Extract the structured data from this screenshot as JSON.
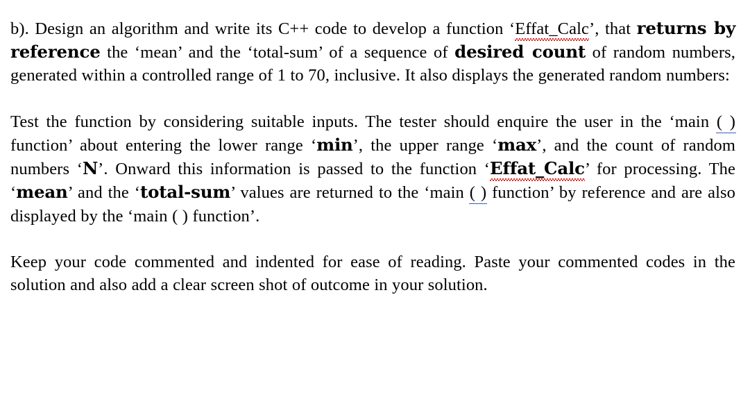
{
  "document": {
    "background_color": "#ffffff",
    "text_color": "#000000",
    "spellcheck_underline_color": "#d93025",
    "grammar_underline_color": "#3b5bbf",
    "paragraphs": [
      {
        "id": "paragraph-1",
        "segments": [
          {
            "text": "b). Design an algorithm and write its C++ code to develop a function ",
            "style": "normal"
          },
          {
            "text": "‘",
            "style": "normal"
          },
          {
            "text": "Effat_Calc",
            "style": "spellcheck"
          },
          {
            "text": "’, that ",
            "style": "normal"
          },
          {
            "text": "returns by reference",
            "style": "bold"
          },
          {
            "text": " the ‘mean’ and the ‘total-sum’ of a sequence of ",
            "style": "normal"
          },
          {
            "text": "desired count",
            "style": "bold"
          },
          {
            "text": " of random numbers, generated within a controlled range of 1 to 70, inclusive. It also displays the generated random numbers:",
            "style": "normal"
          }
        ]
      },
      {
        "id": "paragraph-2",
        "segments": [
          {
            "text": "Test the function by considering suitable inputs. The tester should enquire the user in the ‘main ",
            "style": "normal"
          },
          {
            "text": "( )",
            "style": "grammar"
          },
          {
            "text": " function’ about entering the lower range ‘",
            "style": "normal"
          },
          {
            "text": "min",
            "style": "bold"
          },
          {
            "text": "’, the upper range ‘",
            "style": "normal"
          },
          {
            "text": "max",
            "style": "bold"
          },
          {
            "text": "’, and the count of random numbers ‘",
            "style": "normal"
          },
          {
            "text": "N",
            "style": "bold"
          },
          {
            "text": "’. Onward this information is passed to the function ‘",
            "style": "normal"
          },
          {
            "text": "Effat_Calc",
            "style": "bold-spellcheck"
          },
          {
            "text": "’ for processing. The ‘",
            "style": "normal"
          },
          {
            "text": "mean",
            "style": "bold"
          },
          {
            "text": "’ and the ‘",
            "style": "normal"
          },
          {
            "text": "total-sum",
            "style": "bold"
          },
          {
            "text": "’ values are returned to the ‘main ",
            "style": "normal"
          },
          {
            "text": "( )",
            "style": "grammar"
          },
          {
            "text": " function’ by reference and are also displayed by the ‘main ( ) function’.",
            "style": "normal"
          }
        ]
      },
      {
        "id": "paragraph-3",
        "segments": [
          {
            "text": "Keep your code commented and indented for ease of reading. Paste your commented codes in the solution and also add a clear screen shot of outcome in your solution.",
            "style": "normal"
          }
        ]
      }
    ]
  }
}
